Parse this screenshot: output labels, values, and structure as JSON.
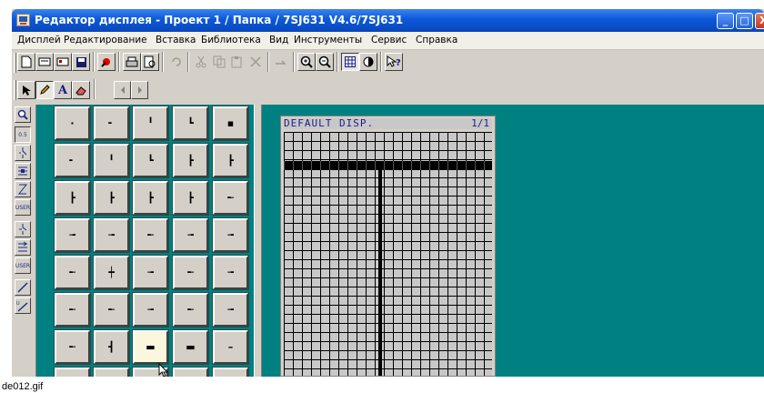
{
  "window": {
    "title": "Редактор дисплея - Проект 1 / Папка / 7SJ631 V4.6/7SJ631",
    "minimize_glyph": "_",
    "maximize_glyph": "□",
    "close_glyph": "X"
  },
  "menu": [
    {
      "label": "Дисплей"
    },
    {
      "label": "Редактирование"
    },
    {
      "label": "Вставка"
    },
    {
      "label": "Библиотека"
    },
    {
      "label": "Вид"
    },
    {
      "label": "Инструменты"
    },
    {
      "label": "Сервис"
    },
    {
      "label": "Справка"
    }
  ],
  "toolbar_icons": [
    "new-icon",
    "open-icon",
    "open-device-icon",
    "save-icon",
    "properties-icon",
    "print-icon",
    "print-preview-icon",
    "undo-icon",
    "cut-icon",
    "copy-icon",
    "paste-icon",
    "delete-icon",
    "redo-icon",
    "zoom-in-icon",
    "zoom-out-icon",
    "grid-icon",
    "contrast-icon",
    "context-help-icon"
  ],
  "draw_tools": {
    "text_tool": "A"
  },
  "sidebar_icons": [
    "zoom-icon",
    "text-icon",
    "switch-icon",
    "breaker-icon",
    "transformer-icon",
    "user-icon",
    "disconnector-icon",
    "earthing-switch-icon",
    "user-symbol-icon",
    "line-icon",
    "user-line-icon"
  ],
  "sidebar_labels": {
    "text": "0.5",
    "user": "USER"
  },
  "palette": {
    "rows": [
      [
        "·",
        "╸",
        "╹",
        "┗",
        "▪"
      ],
      [
        "╸",
        "╹",
        "┗",
        "┣",
        "┣"
      ],
      [
        "┣",
        "┣",
        "┣",
        "┣",
        "╾"
      ],
      [
        "╼",
        "╼",
        "╾",
        "╼",
        "╼"
      ],
      [
        "╾",
        "┿",
        "╼",
        "╾",
        "╼"
      ],
      [
        "╾",
        "╾",
        "╼",
        "╾",
        "╼"
      ],
      [
        "╾",
        "┫",
        "▬",
        "▬",
        "–"
      ]
    ],
    "highlighted": "6.2"
  },
  "display": {
    "header_left": "DEFAULT DISP.",
    "header_right": "1/1"
  },
  "caption": "de012.gif",
  "colors": {
    "background_teal": "#008080",
    "title_blue": "#0a58d8",
    "lcd_text": "#1c1c8c"
  }
}
